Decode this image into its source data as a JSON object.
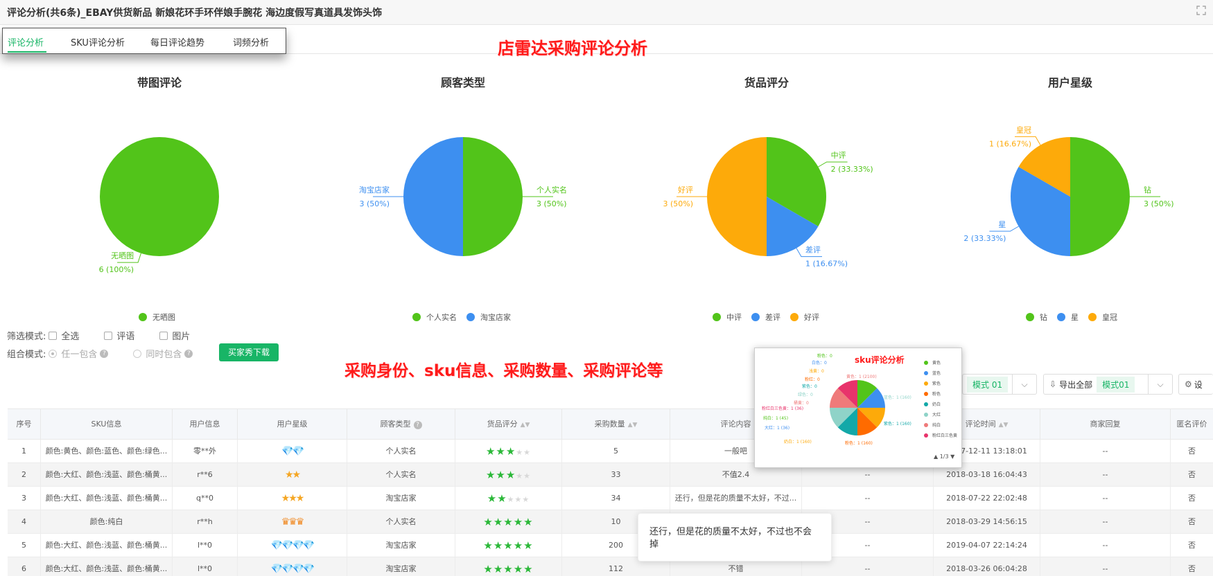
{
  "window": {
    "title": "评论分析(共6条)_EBAY供货新品 新娘花环手环伴娘手腕花 海边度假写真道具发饰头饰",
    "expand_icon": "expand-icon"
  },
  "tabs": [
    "评论分析",
    "SKU评论分析",
    "每日评论趋势",
    "词频分析"
  ],
  "annotations": {
    "top": "店雷达采购评论分析",
    "middle": "采购身份、sku信息、采购数量、采购评论等"
  },
  "colors": {
    "green": "#52c41a",
    "blue": "#3d8ff0",
    "orange": "#fdaa0a",
    "accent": "#18b566",
    "red": "#ff1a1a"
  },
  "charts": [
    {
      "title": "带图评论",
      "slices": [
        {
          "name": "无晒图",
          "value": 6,
          "label": "6 (100%)",
          "color": "#52c41a"
        }
      ],
      "legend": [
        "无晒图"
      ]
    },
    {
      "title": "顾客类型",
      "slices": [
        {
          "name": "个人实名",
          "value": 3,
          "label": "3 (50%)",
          "color": "#52c41a"
        },
        {
          "name": "淘宝店家",
          "value": 3,
          "label": "3 (50%)",
          "color": "#3d8ff0"
        }
      ],
      "legend": [
        "个人实名",
        "淘宝店家"
      ]
    },
    {
      "title": "货品评分",
      "slices": [
        {
          "name": "中评",
          "value": 2,
          "label": "2 (33.33%)",
          "color": "#52c41a"
        },
        {
          "name": "差评",
          "value": 1,
          "label": "1 (16.67%)",
          "color": "#3d8ff0"
        },
        {
          "name": "好评",
          "value": 3,
          "label": "3 (50%)",
          "color": "#fdaa0a"
        }
      ],
      "legend": [
        "中评",
        "差评",
        "好评"
      ]
    },
    {
      "title": "用户星级",
      "slices": [
        {
          "name": "钻",
          "value": 3,
          "label": "3 (50%)",
          "color": "#52c41a"
        },
        {
          "name": "星",
          "value": 2,
          "label": "2 (33.33%)",
          "color": "#3d8ff0"
        },
        {
          "name": "皇冠",
          "value": 1,
          "label": "1 (16.67%)",
          "color": "#fdaa0a"
        }
      ],
      "legend": [
        "钻",
        "星",
        "皇冠"
      ]
    }
  ],
  "filters": {
    "mode_label": "筛选模式:",
    "options": [
      "全选",
      "评语",
      "图片"
    ],
    "combo_label": "组合模式:",
    "combo_options": [
      "任一包含",
      "同时包含"
    ],
    "download": "买家秀下载"
  },
  "toolbar": {
    "mode1": "模式 01",
    "export_all": "导出全部",
    "mode2": "模式01",
    "settings": "设"
  },
  "table": {
    "headers": [
      "序号",
      "SKU信息",
      "用户信息",
      "用户星级",
      "顾客类型",
      "货品评分",
      "采购数量",
      "评论内容",
      "",
      "评论时间",
      "商家回复",
      "匿名评价"
    ],
    "rows": [
      {
        "no": "1",
        "sku": "颜色:黄色、颜色:蓝色、颜色:绿色...",
        "user": "零**外",
        "level": "钻",
        "type": "个人实名",
        "stars": 3,
        "qty": "5",
        "content": "一般吧",
        "extra": "",
        "time": "2017-12-11 13:18:01",
        "reply": "--",
        "anon": "否"
      },
      {
        "no": "2",
        "sku": "颜色:大红、颜色:浅蓝、颜色:桶黄...",
        "user": "r**6",
        "level": "星",
        "type": "个人实名",
        "stars": 3,
        "qty": "33",
        "content": "不值2.4",
        "extra": "--",
        "time": "2018-03-18 16:04:43",
        "reply": "--",
        "anon": "否"
      },
      {
        "no": "3",
        "sku": "颜色:大红、颜色:浅蓝、颜色:桶黄...",
        "user": "q**0",
        "level": "星",
        "type": "淘宝店家",
        "stars": 2,
        "qty": "34",
        "content": "还行，但是花的质量不太好，不过...",
        "extra": "--",
        "time": "2018-07-22 22:02:48",
        "reply": "--",
        "anon": "否"
      },
      {
        "no": "4",
        "sku": "颜色:纯白",
        "user": "r**h",
        "level": "皇冠",
        "type": "个人实名",
        "stars": 5,
        "qty": "10",
        "content": "",
        "extra": "--",
        "time": "2018-03-29 14:56:15",
        "reply": "--",
        "anon": "否"
      },
      {
        "no": "5",
        "sku": "颜色:大红、颜色:浅蓝、颜色:桶黄...",
        "user": "l**0",
        "level": "钻",
        "type": "淘宝店家",
        "stars": 5,
        "qty": "200",
        "content": "",
        "extra": "--",
        "time": "2019-04-07 22:14:24",
        "reply": "--",
        "anon": "否"
      },
      {
        "no": "6",
        "sku": "颜色:大红、颜色:浅蓝、颜色:桶黄...",
        "user": "l**0",
        "level": "钻",
        "type": "淘宝店家",
        "stars": 5,
        "qty": "112",
        "content": "不错",
        "extra": "--",
        "time": "2018-03-26 06:04:28",
        "reply": "--",
        "anon": "否"
      }
    ]
  },
  "tooltip": "还行，但是花的质量不太好，不过也不会掉",
  "popup": {
    "title": "sku评论分析",
    "legend": [
      "黄色",
      "蓝色",
      "紫色",
      "粉色",
      "奶白",
      "大红",
      "纯白",
      "粉红白三色黄"
    ],
    "legend_colors": [
      "#52c41a",
      "#3d8ff0",
      "#fdaa0a",
      "#ff6b00",
      "#13a8a8",
      "#8fd3c8",
      "#ef7a7a",
      "#e8336b"
    ],
    "labels": [
      "粉色：0",
      "白色：0",
      "浅黄：0",
      "粉红：0",
      "紫色：0",
      "绿色：0",
      "桶黄：0",
      "粉红白三色黄：1 (36)",
      "纯白：1 (45)",
      "大红：1 (36)",
      "奶白：1 (160)",
      "粉色：1 (160)",
      "紫色：1 (160)",
      "蓝色：1 (160)",
      "黄色：1 (2100)"
    ],
    "pager": "1/3"
  }
}
